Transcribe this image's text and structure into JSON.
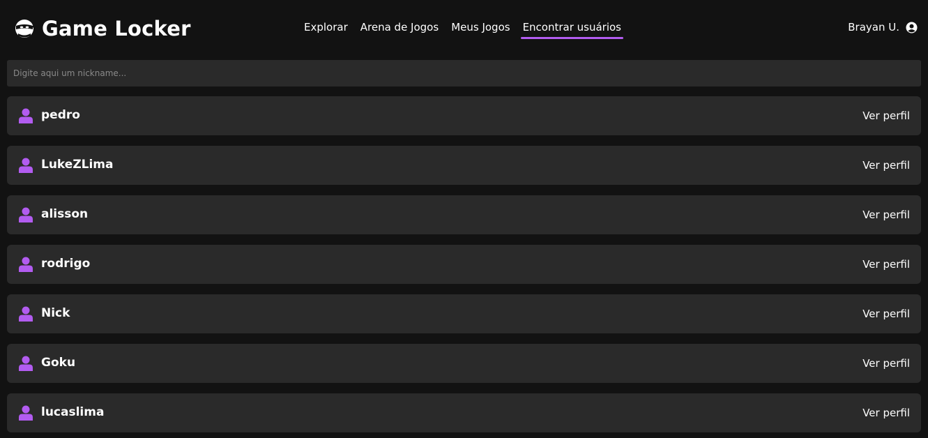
{
  "colors": {
    "background": "#121212",
    "surface": "#2a2a2a",
    "accent": "#b25cf0",
    "text": "#ffffff",
    "placeholder": "#8a8a8a"
  },
  "header": {
    "logo_icon": "ninja-mask-icon",
    "brand": "Game Locker",
    "nav": [
      {
        "label": "Explorar"
      },
      {
        "label": "Arena de Jogos"
      },
      {
        "label": "Meus Jogos"
      },
      {
        "label": "Encontrar usuários",
        "active": true
      }
    ],
    "user": {
      "name": "Brayan U.",
      "icon": "user-circle-icon"
    }
  },
  "search": {
    "placeholder": "Digite aqui um nickname...",
    "value": ""
  },
  "users": {
    "row_icon": "user-icon",
    "action_label": "Ver perfil",
    "items": [
      {
        "nickname": "pedro"
      },
      {
        "nickname": "LukeZLima"
      },
      {
        "nickname": "alisson"
      },
      {
        "nickname": "rodrigo"
      },
      {
        "nickname": "Nick"
      },
      {
        "nickname": "Goku"
      },
      {
        "nickname": "lucaslima"
      }
    ]
  }
}
